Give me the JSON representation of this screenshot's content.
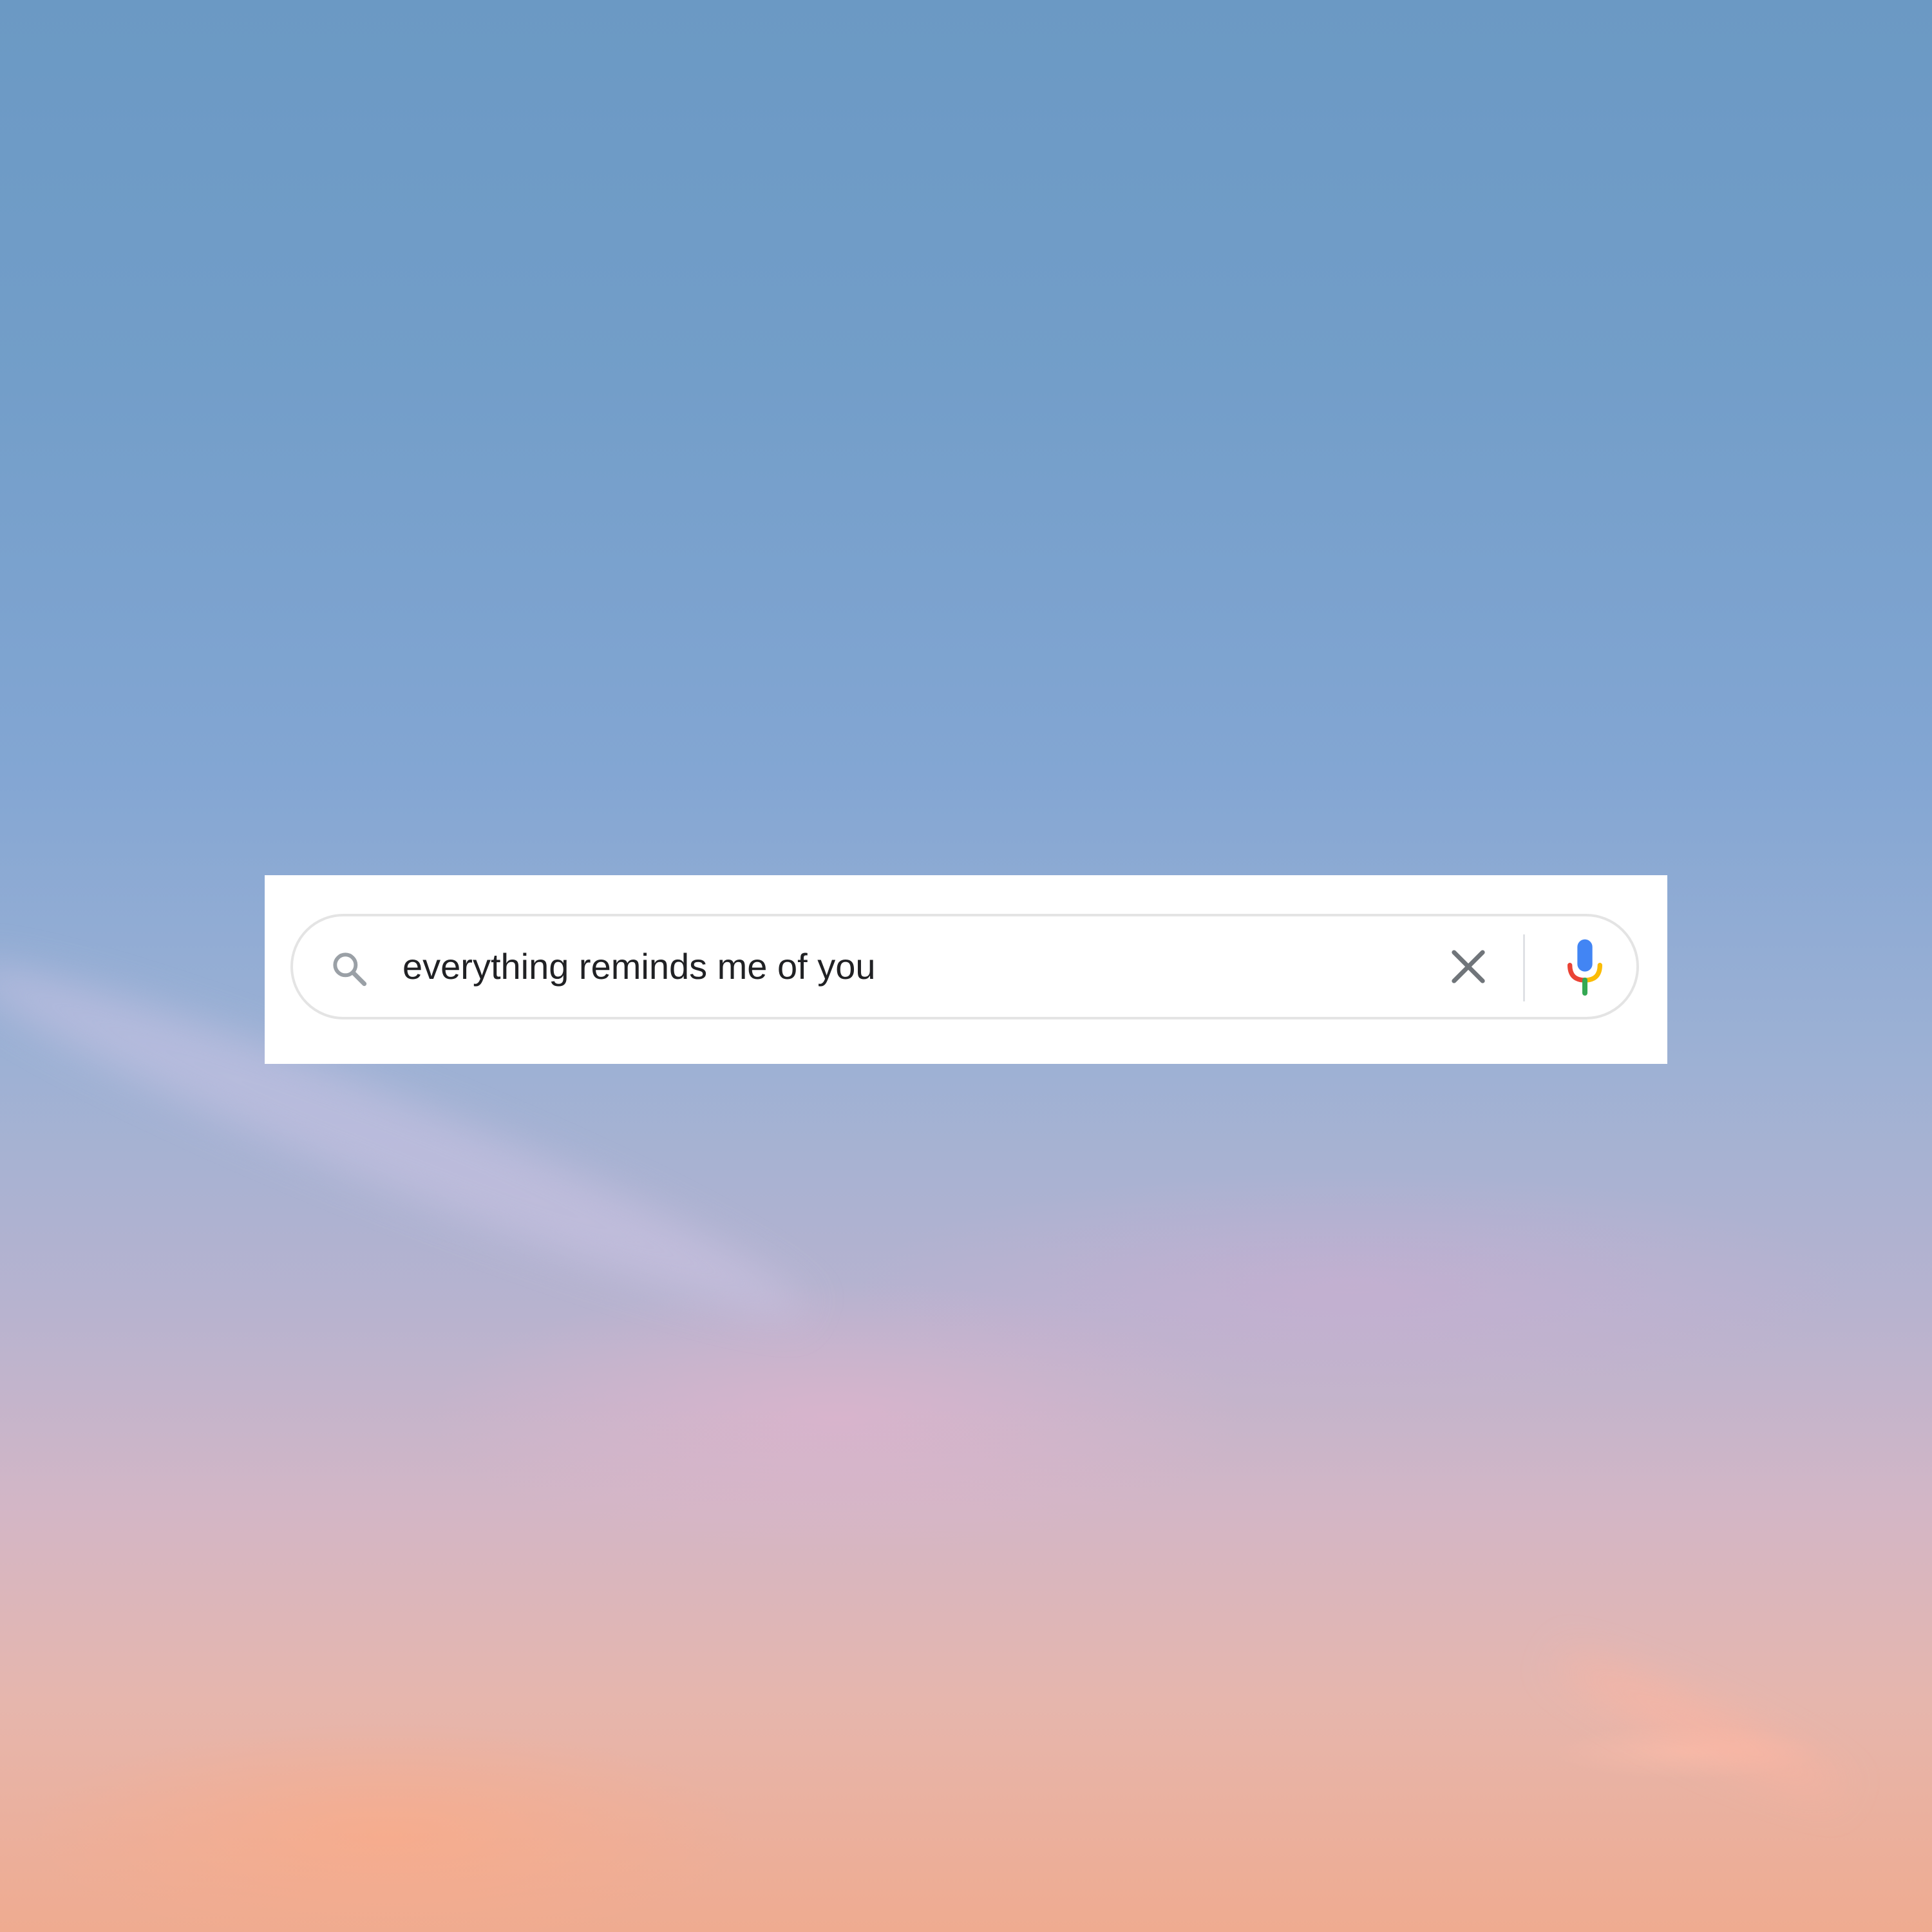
{
  "search": {
    "query": "everything reminds me of you",
    "icons": {
      "leading": "search-icon",
      "clear": "close-icon",
      "voice": "microphone-icon"
    }
  },
  "colors": {
    "sky_top": "#6b99c4",
    "sky_bottom": "#efab90",
    "panel": "#ffffff",
    "text": "#202124",
    "icon_gray": "#70757a",
    "mic_blue": "#4285f4",
    "mic_red": "#ea4335",
    "mic_yellow": "#fbbc05",
    "mic_green": "#34a853"
  }
}
